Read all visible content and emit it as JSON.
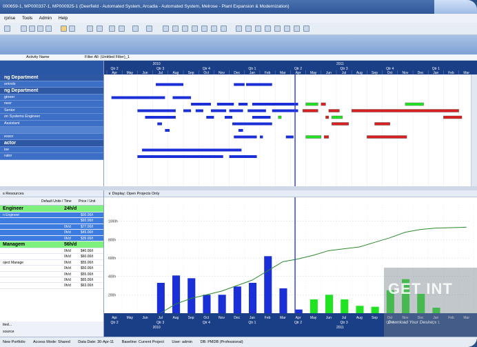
{
  "window": {
    "title": "000659-1, MP000337-1, MP000925-1 (Deerfield - Automated System, Arcadia - Automated System, Melrose - Plant Expansion & Modernization)"
  },
  "menu": {
    "items": [
      "rprise",
      "Tools",
      "Admin",
      "Help"
    ]
  },
  "filter_bar": {
    "activity_name": "Activity Name",
    "filter": "Filter All: (Untitled Filter)_1"
  },
  "timeline": {
    "years": [
      "2010",
      "2011"
    ],
    "quarters": [
      "Qtr 2",
      "Qtr 3",
      "Qtr 4",
      "Qtr 1",
      "Qtr 2",
      "Qtr 3",
      "Qtr 4",
      "Qtr 1"
    ],
    "months": [
      "Apr",
      "May",
      "Jun",
      "Jul",
      "Aug",
      "Sep",
      "Oct",
      "Nov",
      "Dec",
      "Jan",
      "Feb",
      "Mar",
      "Apr",
      "May",
      "Jun",
      "Jul",
      "Aug",
      "Sep",
      "Oct",
      "Nov",
      "Dec",
      "Jan",
      "Feb",
      "Mar"
    ]
  },
  "activities": [
    {
      "label": "ng Department",
      "type": "dept"
    },
    {
      "label": "ontrols",
      "type": "row"
    },
    {
      "label": "ng Department",
      "type": "dept"
    },
    {
      "label": "gineer",
      "type": "row"
    },
    {
      "label": "neer",
      "type": "row"
    },
    {
      "label": "Senior",
      "type": "row"
    },
    {
      "label": "on Systems Engineer",
      "type": "row"
    },
    {
      "label": "Assistant",
      "type": "row"
    },
    {
      "label": "",
      "type": "light"
    },
    {
      "label": "essor",
      "type": "row"
    },
    {
      "label": "actor",
      "type": "dept"
    },
    {
      "label": "ise",
      "type": "row"
    },
    {
      "label": "rator",
      "type": "row"
    }
  ],
  "resources": {
    "title": "s Resources",
    "columns": [
      "Default Units / Time",
      "Price / Unit"
    ],
    "rows": [
      {
        "name": "Engineer",
        "units": "24h/d",
        "price": "",
        "type": "res"
      },
      {
        "name": "n Engineer",
        "units": "",
        "price": "$00.00/t",
        "type": "sel"
      },
      {
        "name": "",
        "units": "",
        "price": "$92.00/t",
        "type": "sel"
      },
      {
        "name": "",
        "units": "0h/d",
        "price": "$77.00/t",
        "type": "sel"
      },
      {
        "name": "",
        "units": "0h/d",
        "price": "$45.00/t",
        "type": "sel"
      },
      {
        "name": "",
        "units": "0h/d",
        "price": "$35.00/t",
        "type": "sel"
      },
      {
        "name": "Managem",
        "units": "56h/d",
        "price": "",
        "type": "res"
      },
      {
        "name": "",
        "units": "0h/d",
        "price": "$40.00/t",
        "type": "row"
      },
      {
        "name": "",
        "units": "0h/d",
        "price": "$60.00/t",
        "type": "row"
      },
      {
        "name": "oject Manage",
        "units": "0h/d",
        "price": "$55.00/t",
        "type": "row"
      },
      {
        "name": "",
        "units": "0h/d",
        "price": "$50.00/t",
        "type": "row"
      },
      {
        "name": "",
        "units": "0h/d",
        "price": "$55.00/t",
        "type": "row"
      },
      {
        "name": "",
        "units": "0h/d",
        "price": "$65.00/t",
        "type": "row"
      },
      {
        "name": "",
        "units": "0h/d",
        "price": "$63.00/t",
        "type": "row"
      }
    ],
    "footer_top": "ited...",
    "footer_bottom": "source"
  },
  "histogram_pane": {
    "title": "Display: Open Projects Only"
  },
  "status_bar": {
    "items": [
      "New Portfolio",
      "Access Mode: Shared",
      "Data Date: 30-Apr-11",
      "Baseline: Current Project",
      "User: admin",
      "DB: PMDB (Professional)"
    ]
  },
  "watermark": {
    "title": "GET INT",
    "tagline": "Download Your Desire"
  },
  "colors": {
    "bar_blue": "#1a2fd6",
    "bar_green": "#22e322",
    "bar_red": "#d82020",
    "cumulative_line": "#2b8a2b",
    "data_date": "#3344dd"
  },
  "gantt_bars": [
    {
      "row": 1,
      "start": 3.2,
      "end": 5.0,
      "color": "blue"
    },
    {
      "row": 1,
      "start": 8.3,
      "end": 9.0,
      "color": "blue"
    },
    {
      "row": 1,
      "start": 9.1,
      "end": 10.8,
      "color": "blue"
    },
    {
      "row": 3,
      "start": 0.3,
      "end": 3.8,
      "color": "blue"
    },
    {
      "row": 3,
      "start": 4.3,
      "end": 5.5,
      "color": "blue"
    },
    {
      "row": 4,
      "start": 5.5,
      "end": 6.8,
      "color": "blue"
    },
    {
      "row": 4,
      "start": 7.2,
      "end": 8.3,
      "color": "blue"
    },
    {
      "row": 4,
      "start": 8.6,
      "end": 9.2,
      "color": "blue"
    },
    {
      "row": 4,
      "start": 9.5,
      "end": 12.5,
      "color": "blue"
    },
    {
      "row": 4,
      "start": 13.0,
      "end": 13.8,
      "color": "green"
    },
    {
      "row": 4,
      "start": 14.0,
      "end": 14.3,
      "color": "red"
    },
    {
      "row": 4,
      "start": 19.5,
      "end": 20.7,
      "color": "green"
    },
    {
      "row": 5,
      "start": 2.0,
      "end": 4.5,
      "color": "blue"
    },
    {
      "row": 5,
      "start": 5.0,
      "end": 5.5,
      "color": "blue"
    },
    {
      "row": 5,
      "start": 5.8,
      "end": 6.3,
      "color": "blue"
    },
    {
      "row": 5,
      "start": 6.8,
      "end": 7.8,
      "color": "blue"
    },
    {
      "row": 5,
      "start": 8.0,
      "end": 8.9,
      "color": "blue"
    },
    {
      "row": 5,
      "start": 9.2,
      "end": 10.4,
      "color": "blue"
    },
    {
      "row": 5,
      "start": 10.8,
      "end": 12.5,
      "color": "blue"
    },
    {
      "row": 5,
      "start": 12.8,
      "end": 13.8,
      "color": "red"
    },
    {
      "row": 5,
      "start": 14.5,
      "end": 15.2,
      "color": "red"
    },
    {
      "row": 5,
      "start": 16.0,
      "end": 23.0,
      "color": "red"
    },
    {
      "row": 6,
      "start": 2.5,
      "end": 4.5,
      "color": "blue"
    },
    {
      "row": 6,
      "start": 6.5,
      "end": 7.0,
      "color": "blue"
    },
    {
      "row": 6,
      "start": 7.7,
      "end": 8.2,
      "color": "blue"
    },
    {
      "row": 6,
      "start": 9.5,
      "end": 10.7,
      "color": "blue"
    },
    {
      "row": 6,
      "start": 11.2,
      "end": 11.4,
      "color": "green"
    },
    {
      "row": 6,
      "start": 14.3,
      "end": 14.5,
      "color": "red"
    },
    {
      "row": 6,
      "start": 14.7,
      "end": 15.4,
      "color": "green"
    },
    {
      "row": 6,
      "start": 22.0,
      "end": 23.2,
      "color": "red"
    },
    {
      "row": 7,
      "start": 3.3,
      "end": 3.6,
      "color": "blue"
    },
    {
      "row": 7,
      "start": 8.2,
      "end": 10.8,
      "color": "blue"
    },
    {
      "row": 7,
      "start": 14.7,
      "end": 15.8,
      "color": "red"
    },
    {
      "row": 7,
      "start": 17.5,
      "end": 18.5,
      "color": "red"
    },
    {
      "row": 8,
      "start": 3.8,
      "end": 4.1,
      "color": "blue"
    },
    {
      "row": 8,
      "start": 8.6,
      "end": 8.9,
      "color": "blue"
    },
    {
      "row": 9,
      "start": 8.3,
      "end": 9.8,
      "color": "blue"
    },
    {
      "row": 9,
      "start": 10.0,
      "end": 10.2,
      "color": "blue"
    },
    {
      "row": 9,
      "start": 11.7,
      "end": 12.2,
      "color": "blue"
    },
    {
      "row": 9,
      "start": 13.0,
      "end": 14.0,
      "color": "green"
    },
    {
      "row": 9,
      "start": 14.2,
      "end": 14.5,
      "color": "red"
    },
    {
      "row": 9,
      "start": 17.0,
      "end": 19.6,
      "color": "red"
    },
    {
      "row": 11,
      "start": 2.3,
      "end": 8.8,
      "color": "blue"
    },
    {
      "row": 12,
      "start": 2.0,
      "end": 7.6,
      "color": "blue"
    },
    {
      "row": 12,
      "start": 8.0,
      "end": 9.8,
      "color": "blue"
    }
  ],
  "chart_data": {
    "type": "bar",
    "title": "",
    "xlabel": "",
    "ylabel": "",
    "y_ticks": [
      "200h",
      "400h",
      "600h",
      "800h",
      "1000h"
    ],
    "ylim": [
      0,
      1200
    ],
    "categories": [
      "Apr",
      "May",
      "Jun",
      "Jul",
      "Aug",
      "Sep",
      "Oct",
      "Nov",
      "Dec",
      "Jan",
      "Feb",
      "Mar",
      "Apr",
      "May",
      "Jun",
      "Jul",
      "Aug",
      "Sep",
      "Oct",
      "Nov",
      "Dec",
      "Jan",
      "Feb",
      "Mar"
    ],
    "series": [
      {
        "values": [
          0,
          0,
          0,
          330,
          410,
          380,
          200,
          200,
          290,
          330,
          620,
          270,
          40,
          0,
          0,
          0,
          0,
          0,
          0,
          0,
          0,
          0,
          0,
          0
        ]
      },
      {
        "values": [
          0,
          0,
          0,
          0,
          0,
          0,
          0,
          0,
          0,
          0,
          0,
          0,
          0,
          150,
          200,
          150,
          80,
          70,
          250,
          370,
          210,
          60,
          0,
          0
        ]
      },
      {
        "values": [
          0,
          0,
          0,
          0,
          100,
          160,
          200,
          240,
          300,
          360,
          460,
          560,
          590,
          630,
          680,
          700,
          720,
          770,
          820,
          880,
          910,
          925,
          930,
          935
        ]
      }
    ],
    "data_date": "Apr 2011",
    "grid": true
  }
}
